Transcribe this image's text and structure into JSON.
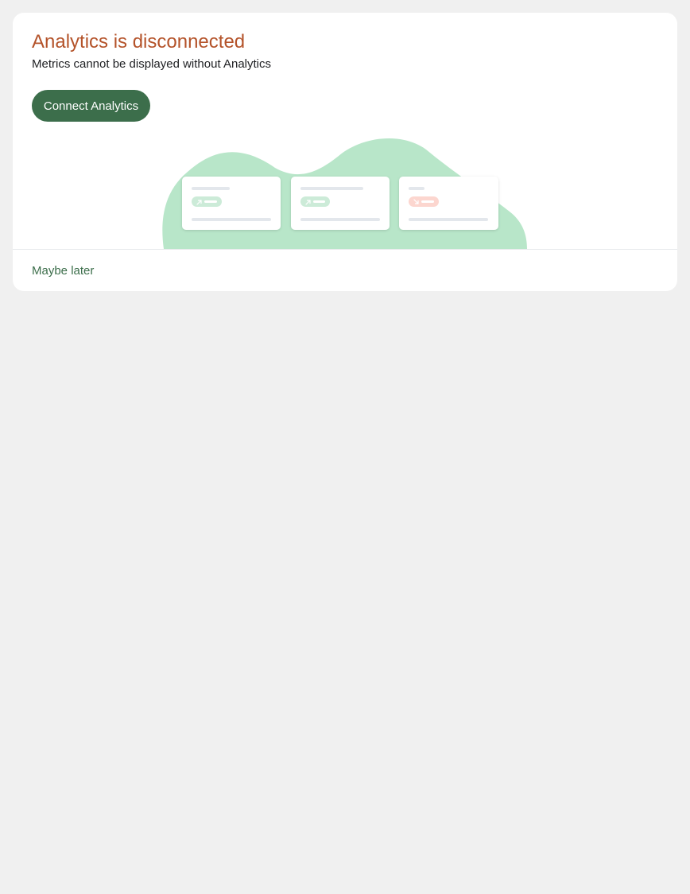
{
  "banner": {
    "title": "Analytics is disconnected",
    "description": "Metrics cannot be displayed without Analytics",
    "connect_label": "Connect Analytics",
    "dismiss_label": "Maybe later"
  },
  "colors": {
    "title": "#b4532a",
    "accent": "#3c6e4b",
    "blob": "#b8e6c9",
    "positive_chip": "#ccebd8",
    "negative_chip": "#fcd6cf"
  },
  "illustration": {
    "cards": [
      {
        "trend": "up",
        "icon": "arrow-up-right-icon"
      },
      {
        "trend": "up",
        "icon": "arrow-up-right-icon"
      },
      {
        "trend": "down",
        "icon": "arrow-down-right-icon"
      }
    ]
  }
}
